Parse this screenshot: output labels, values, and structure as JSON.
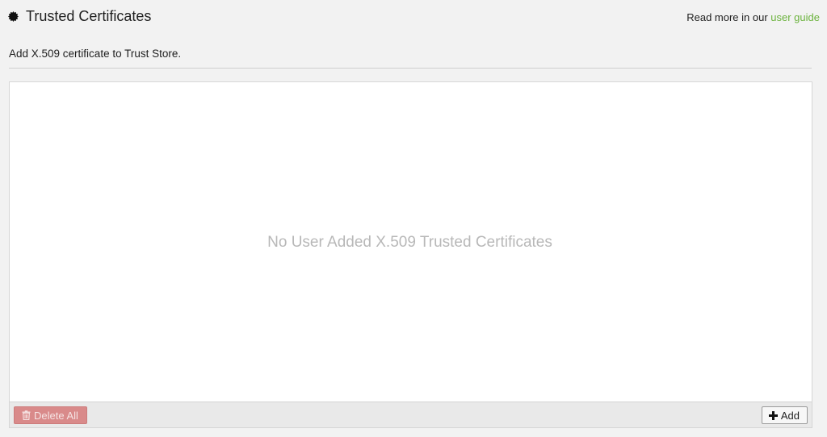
{
  "header": {
    "title": "Trusted Certificates",
    "title_icon": "seal-badge-icon",
    "help_prefix": "Read more in our ",
    "help_link_label": "user guide"
  },
  "subtitle": "Add X.509 certificate to Trust Store.",
  "panel": {
    "empty_message": "No User Added X.509 Trusted Certificates"
  },
  "footer": {
    "delete_all_label": "Delete All",
    "delete_icon": "trash-icon",
    "add_label": "Add",
    "add_icon": "plus-icon"
  },
  "colors": {
    "link": "#6cb33e",
    "danger_disabled": "#d98a8a",
    "background": "#f2f2f2"
  }
}
